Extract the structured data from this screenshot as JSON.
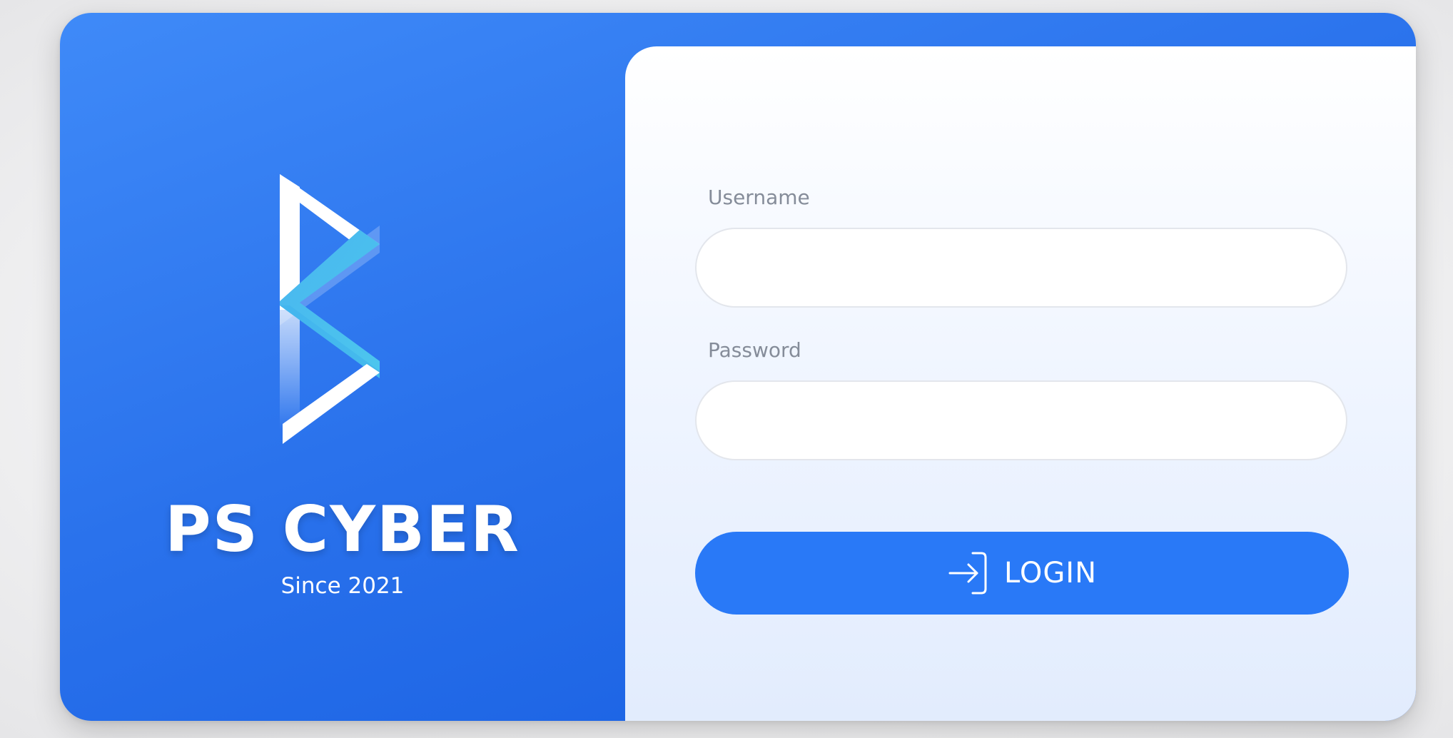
{
  "brand": {
    "name": "PS CYBER",
    "since": "Since 2021",
    "logo_icon": "ps-cyber-chevron-logo-icon"
  },
  "form": {
    "username_label": "Username",
    "username_value": "",
    "password_label": "Password",
    "password_value": "",
    "login_label": "LOGIN",
    "login_icon": "sign-in-arrow-icon"
  },
  "colors": {
    "brand_blue": "#2979f7",
    "accent_cyan": "#4cc3ee",
    "label_gray": "#858c99"
  }
}
